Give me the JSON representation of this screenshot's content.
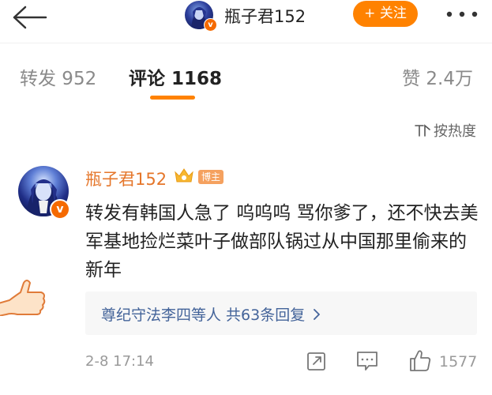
{
  "header": {
    "title": "瓶子君152",
    "follow_label": "+ 关注",
    "verified_badge": "v"
  },
  "tabs": [
    {
      "label": "转发 952"
    },
    {
      "label": "评论 1168"
    },
    {
      "label": "赞 2.4万"
    }
  ],
  "sort": {
    "label": "按热度"
  },
  "comment": {
    "username": "瓶子君152",
    "role_badge": "博主",
    "verified_badge": "v",
    "text": "转发有韩国人急了 呜呜呜 骂你爹了，还不快去美军基地捡烂菜叶子做部队锅过从中国那里偷来的新年",
    "replies_label": "尊纪守法李四等人 共63条回复",
    "time": "2-8 17:14",
    "like_count": "1577"
  },
  "colors": {
    "accent": "#ff8200",
    "username": "#e5762a",
    "link": "#44649a"
  }
}
